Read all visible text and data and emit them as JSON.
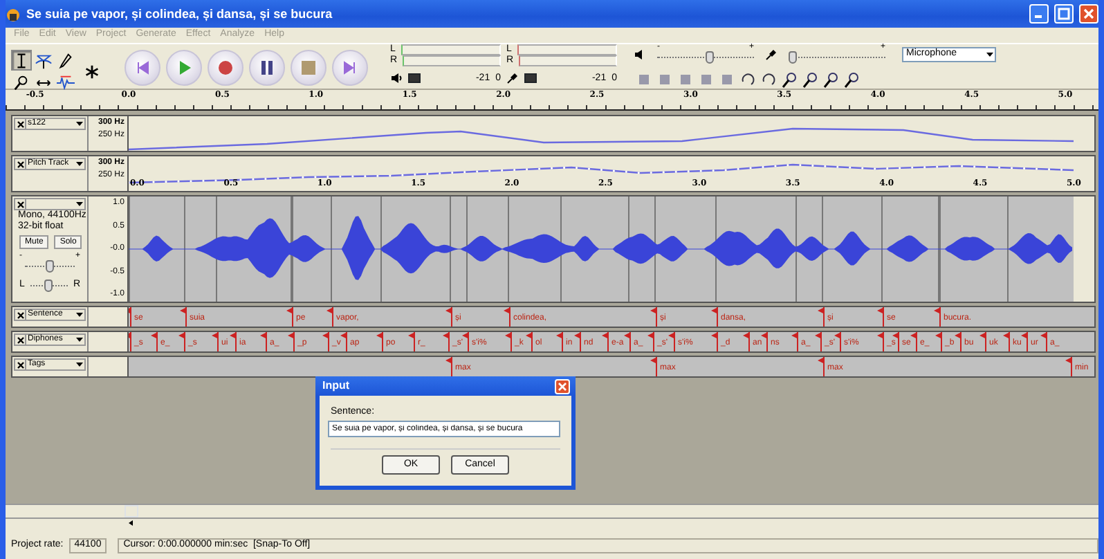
{
  "window": {
    "title": "Se suia pe vapor, și colindea, și dansa, și se bucura"
  },
  "menu": [
    "File",
    "Edit",
    "View",
    "Project",
    "Generate",
    "Effect",
    "Analyze",
    "Help"
  ],
  "tools": [
    {
      "kind": "select",
      "selected": true
    },
    {
      "kind": "envelope",
      "selected": false
    },
    {
      "kind": "draw",
      "selected": false
    },
    {
      "kind": "zoom",
      "selected": false
    },
    {
      "kind": "timeshift",
      "selected": false
    },
    {
      "kind": "wave",
      "selected": false
    },
    {
      "kind": "multi",
      "selected": false
    }
  ],
  "transport": [
    {
      "kind": "skip-start"
    },
    {
      "kind": "play"
    },
    {
      "kind": "record"
    },
    {
      "kind": "pause"
    },
    {
      "kind": "stop"
    },
    {
      "kind": "skip-end"
    }
  ],
  "meters": [
    {
      "kind": "output",
      "channels": [
        "L",
        "R"
      ],
      "scale": [
        "-21",
        "0"
      ]
    },
    {
      "kind": "input",
      "channels": [
        "L",
        "R"
      ],
      "scale": [
        "-21",
        "0"
      ]
    }
  ],
  "mixer": [
    {
      "kind": "output",
      "min_mark": "-",
      "max_mark": "+",
      "level": 0.55
    },
    {
      "kind": "input",
      "max_mark": "+",
      "level": 0.0
    }
  ],
  "input_source": "Microphone",
  "ruler": {
    "ticks": [
      "-0.5",
      "0.0",
      "0.5",
      "1.0",
      "1.5",
      "2.0",
      "2.5",
      "3.0",
      "3.5",
      "4.0",
      "4.5",
      "5.0"
    ]
  },
  "tracks": [
    {
      "kind": "pitch",
      "name": "s122",
      "scale": [
        "300 Hz",
        "250 Hz"
      ]
    },
    {
      "kind": "pitch",
      "name": "Pitch Track",
      "scale": [
        "300 Hz",
        "250 Hz"
      ],
      "time_marks": [
        "0.0",
        "0.5",
        "1.0",
        "1.5",
        "2.0",
        "2.5",
        "3.0",
        "3.5",
        "4.0",
        "4.5",
        "5.0"
      ]
    },
    {
      "kind": "audio",
      "info": [
        "Mono, 44100Hz",
        "32-bit float"
      ],
      "mute": "Mute",
      "solo": "Solo",
      "gain": {
        "min": "-",
        "max": "+",
        "level": 0.5
      },
      "pan": {
        "left": "L",
        "right": "R",
        "level": 0.5
      },
      "scale": [
        "1.0",
        "0.5",
        "-0.0",
        "-0.5",
        "-1.0"
      ]
    },
    {
      "kind": "label",
      "name": "Sentence",
      "labels": [
        "se",
        "suia",
        "pe",
        "vapor,",
        "și",
        "colindea,",
        "și",
        "dansa,",
        "și",
        "se",
        "bucura."
      ]
    },
    {
      "kind": "label",
      "name": "Diphones",
      "labels": [
        "_s",
        "e_",
        "_s",
        "ui",
        "ia",
        "a_",
        "_p",
        "_v",
        "ap",
        "po",
        "r_",
        "_s'",
        "s'i%",
        "_k",
        "ol",
        "in",
        "nd",
        "e-a",
        "a_",
        "_s'",
        "s'i%",
        "_d",
        "an",
        "ns",
        "a_",
        "_s'",
        "s'i%",
        "_s",
        "se",
        "e_",
        "_b",
        "bu",
        "uk",
        "ku",
        "ur",
        "a_"
      ]
    },
    {
      "kind": "label",
      "name": "Tags",
      "labels": [
        "max",
        "max",
        "max",
        "min"
      ]
    }
  ],
  "dialog": {
    "title": "Input",
    "prompt": "Sentence:",
    "value": "Se suia pe vapor, și colindea, și dansa, și se bucura",
    "buttons": [
      "OK",
      "Cancel"
    ]
  },
  "status": {
    "rate_label": "Project rate:",
    "rate": "44100",
    "cursor": "Cursor: 0:00.000000 min:sec  [Snap-To Off]"
  }
}
